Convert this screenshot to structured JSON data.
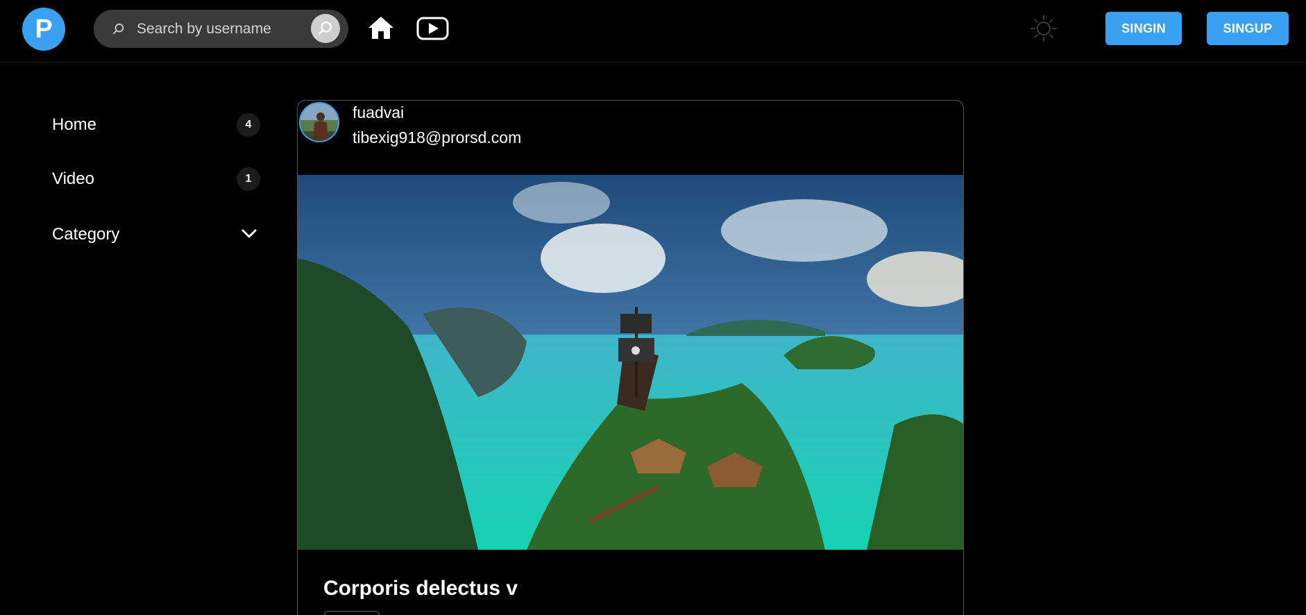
{
  "header": {
    "logo_letter": "P",
    "search_placeholder": "Search by username",
    "signin_label": "SINGIN",
    "signup_label": "SINGUP"
  },
  "sidebar": {
    "items": [
      {
        "label": "Home",
        "count": "4"
      },
      {
        "label": "Video",
        "count": "1"
      },
      {
        "label": "Category"
      }
    ]
  },
  "post": {
    "username": "fuadvai",
    "email": "tibexig918@prorsd.com",
    "title": "Corporis delectus v"
  },
  "colors": {
    "accent": "#3aa0f2",
    "background": "#000000",
    "search_bg": "#3a3a3a"
  },
  "icons": [
    "search-icon",
    "home-icon",
    "youtube-icon",
    "sun-icon",
    "chevron-down-icon"
  ]
}
